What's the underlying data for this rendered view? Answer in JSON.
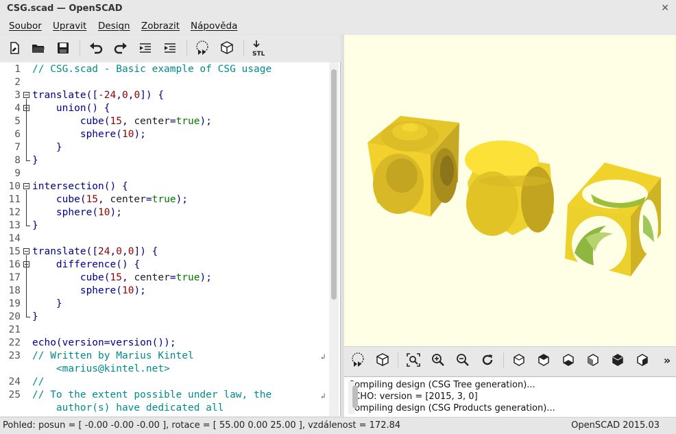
{
  "window": {
    "title": "CSG.scad — OpenSCAD",
    "close_glyph": "✕"
  },
  "menu": [
    "Soubor",
    "Upravit",
    "Design",
    "Zobrazit",
    "Nápověda"
  ],
  "toolbar": {
    "icons": [
      "new-file-icon",
      "open-file-icon",
      "save-icon",
      "undo-icon",
      "redo-icon",
      "unindent-icon",
      "indent-icon",
      "preview-icon",
      "render-icon",
      "export-stl-icon"
    ],
    "stl_label": "STL"
  },
  "editor": {
    "lines": [
      {
        "n": "1",
        "text": "// CSG.scad - Basic example of CSG usage"
      },
      {
        "n": "2",
        "text": ""
      },
      {
        "n": "3",
        "text": "translate([-24,0,0]) {"
      },
      {
        "n": "4",
        "text": "    union() {"
      },
      {
        "n": "5",
        "text": "        cube(15, center=true);"
      },
      {
        "n": "6",
        "text": "        sphere(10);"
      },
      {
        "n": "7",
        "text": "    }"
      },
      {
        "n": "8",
        "text": "}"
      },
      {
        "n": "9",
        "text": ""
      },
      {
        "n": "10",
        "text": "intersection() {"
      },
      {
        "n": "11",
        "text": "    cube(15, center=true);"
      },
      {
        "n": "12",
        "text": "    sphere(10);"
      },
      {
        "n": "13",
        "text": "}"
      },
      {
        "n": "14",
        "text": ""
      },
      {
        "n": "15",
        "text": "translate([24,0,0]) {"
      },
      {
        "n": "16",
        "text": "    difference() {"
      },
      {
        "n": "17",
        "text": "        cube(15, center=true);"
      },
      {
        "n": "18",
        "text": "        sphere(10);"
      },
      {
        "n": "19",
        "text": "    }"
      },
      {
        "n": "20",
        "text": "}"
      },
      {
        "n": "21",
        "text": ""
      },
      {
        "n": "22",
        "text": "echo(version=version());"
      },
      {
        "n": "23",
        "text": "// Written by Marius Kintel"
      },
      {
        "n": "",
        "text": "    <marius@kintel.net>"
      },
      {
        "n": "24",
        "text": "//"
      },
      {
        "n": "25",
        "text": "// To the extent possible under law, the"
      },
      {
        "n": "",
        "text": "    author(s) have dedicated all"
      }
    ]
  },
  "viewport": {
    "background": "#ffffe5",
    "objects": [
      "union-cube-sphere",
      "intersection-cube-sphere",
      "difference-cube-sphere"
    ],
    "object_color": "#f9d72c"
  },
  "view_toolbar": {
    "icons": [
      "preview-icon",
      "render-icon",
      "zoom-all-icon",
      "zoom-in-icon",
      "zoom-out-icon",
      "reset-view-icon",
      "view-right-icon",
      "view-top-icon",
      "view-bottom-icon",
      "view-left-icon",
      "view-front-icon",
      "view-back-icon",
      "more-icon"
    ],
    "more_glyph": "»"
  },
  "console": {
    "lines": [
      "Compiling design (CSG Tree generation)...",
      "ECHO: version = [2015, 3, 0]",
      "Compiling design (CSG Products generation)..."
    ]
  },
  "status": {
    "view": "Pohled: posun = [ -0.00 -0.00 -0.00 ], rotace = [ 55.00 0.00 25.00 ], vzdálenost = 172.84",
    "version": "OpenSCAD 2015.03"
  }
}
